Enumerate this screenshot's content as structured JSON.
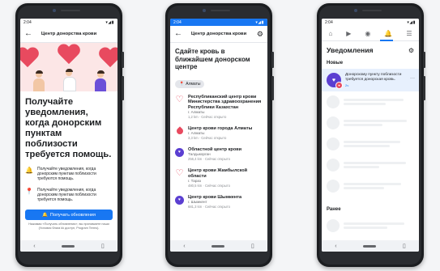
{
  "status_time": "2:04",
  "status_icons": "▾◢▮",
  "screen1": {
    "title": "Центр донорства крови",
    "headline": "Получайте уведомления, когда донорским пунктам поблизости требуется помощь.",
    "rows": [
      {
        "icon": "bell-icon",
        "glyph": "🔔",
        "text": "Получайте уведомления, когда донорским пунктам поблизости требуются помощь."
      },
      {
        "icon": "location-pin-icon",
        "glyph": "📍",
        "text": "Получайте уведомления, когда донорским пунктам поблизости требуется помощь."
      }
    ],
    "button_label": "Получать обновления",
    "fineprint": "Нажимая «Получать обновления», вы принимаете наши (Условия блага kk доступ, Program Terms)."
  },
  "screen2": {
    "title": "Центр донорства крови",
    "headline": "Сдайте кровь в ближайшем донорском центре",
    "location_chip": "Алматы",
    "centers": [
      {
        "icon": "heart",
        "name": "Республиканский центр крови Министерства здравоохранения Республики Казахстан",
        "city": "г. Алматы",
        "dist": "1,2 km · Сейчас открыто"
      },
      {
        "icon": "drop",
        "name": "Центр крови города Алматы",
        "city": "г. Алматы",
        "dist": "3,3 km · Сейчас открыто"
      },
      {
        "icon": "badge",
        "name": "Областной центр крови",
        "city": "Талдыкорган",
        "dist": "256,4 km · Сейчас открыто"
      },
      {
        "icon": "heart",
        "name": "Центр крови Жамбылской области",
        "city": "г. Тараз",
        "dist": "480,5 km · Сейчас открыто"
      },
      {
        "icon": "badge",
        "name": "Центр крови Шымкента",
        "city": "г. Шымкент",
        "dist": "681,3 km · Сейчас открыто"
      }
    ]
  },
  "screen3": {
    "title": "Уведомления",
    "section_new": "Новые",
    "notification_text": "Донорскому пункту поблизости требуется донорская кровь.",
    "notification_time": "2ч",
    "section_earlier": "Ранее"
  }
}
